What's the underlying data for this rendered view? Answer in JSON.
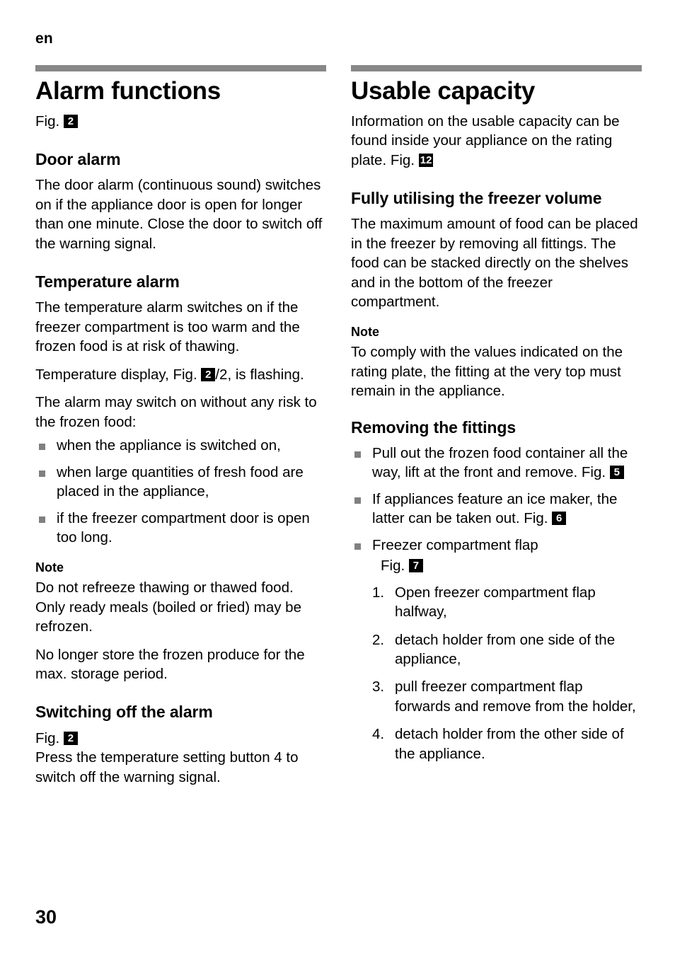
{
  "page": {
    "running_head": "en",
    "page_number": "30"
  },
  "left_column": {
    "chapter_title": "Alarm functions",
    "fig_intro_label": "Fig.",
    "fig_intro_ref": "2",
    "door_alarm": {
      "heading": "Door alarm",
      "paragraph": "The door alarm (continuous sound) switches on if the appliance door is open for longer than one minute. Close the door to switch off the warning signal."
    },
    "temperature_alarm": {
      "heading": "Temperature alarm",
      "paragraph_1": "The temperature alarm switches on if the freezer compartment is too warm and the frozen food is at risk of thawing.",
      "display_prefix": "Temperature display, Fig.",
      "display_ref": "2",
      "display_suffix": "/2, is flashing.",
      "paragraph_2": "The alarm may switch on without any risk to the frozen food:",
      "bullets": [
        "when the appliance is switched on,",
        "when large quantities of fresh food are placed in the appliance,",
        "if the freezer compartment door is open too long."
      ],
      "note_heading": "Note",
      "note_paragraph_1": "Do not refreeze thawing or thawed food. Only ready meals (boiled or fried) may be refrozen.",
      "note_paragraph_2": "No longer store the frozen produce for the max. storage period."
    },
    "switching_off": {
      "heading": "Switching off the alarm",
      "fig_label": "Fig.",
      "fig_ref": "2",
      "paragraph": "Press the temperature setting button 4 to switch off the warning signal."
    }
  },
  "right_column": {
    "chapter_title": "Usable capacity",
    "intro_prefix": "Information on the usable capacity can be found inside your appliance on the rating plate. Fig.",
    "intro_ref": "12",
    "fully_utilising": {
      "heading": "Fully utilising the freezer volume",
      "paragraph": "The maximum amount of food can be placed in the freezer by removing all fittings. The food can be stacked directly on the shelves and in the bottom of the freezer compartment.",
      "note_heading": "Note",
      "note_paragraph": "To comply with the values indicated on the rating plate, the fitting at the very top must remain in the appliance."
    },
    "removing_fittings": {
      "heading": "Removing the fittings",
      "bullet_1_text": "Pull out the frozen food container all the way, lift at the front and remove. Fig.",
      "bullet_1_ref": "5",
      "bullet_2_text": "If appliances feature an ice maker, the latter can be taken out. Fig.",
      "bullet_2_ref": "6",
      "bullet_3_text": "Freezer compartment flap",
      "bullet_3_fig_label": "Fig.",
      "bullet_3_fig_ref": "7",
      "steps": [
        {
          "num": "1.",
          "text": "Open freezer compartment flap halfway,"
        },
        {
          "num": "2.",
          "text": "detach holder from one side of the appliance,"
        },
        {
          "num": "3.",
          "text": "pull freezer compartment flap forwards and remove from the holder,"
        },
        {
          "num": "4.",
          "text": "detach holder from the other side of the appliance."
        }
      ]
    }
  },
  "colors": {
    "rule": "#878787",
    "bullet": "#808080",
    "badge_bg": "#000000",
    "badge_text": "#ffffff"
  }
}
